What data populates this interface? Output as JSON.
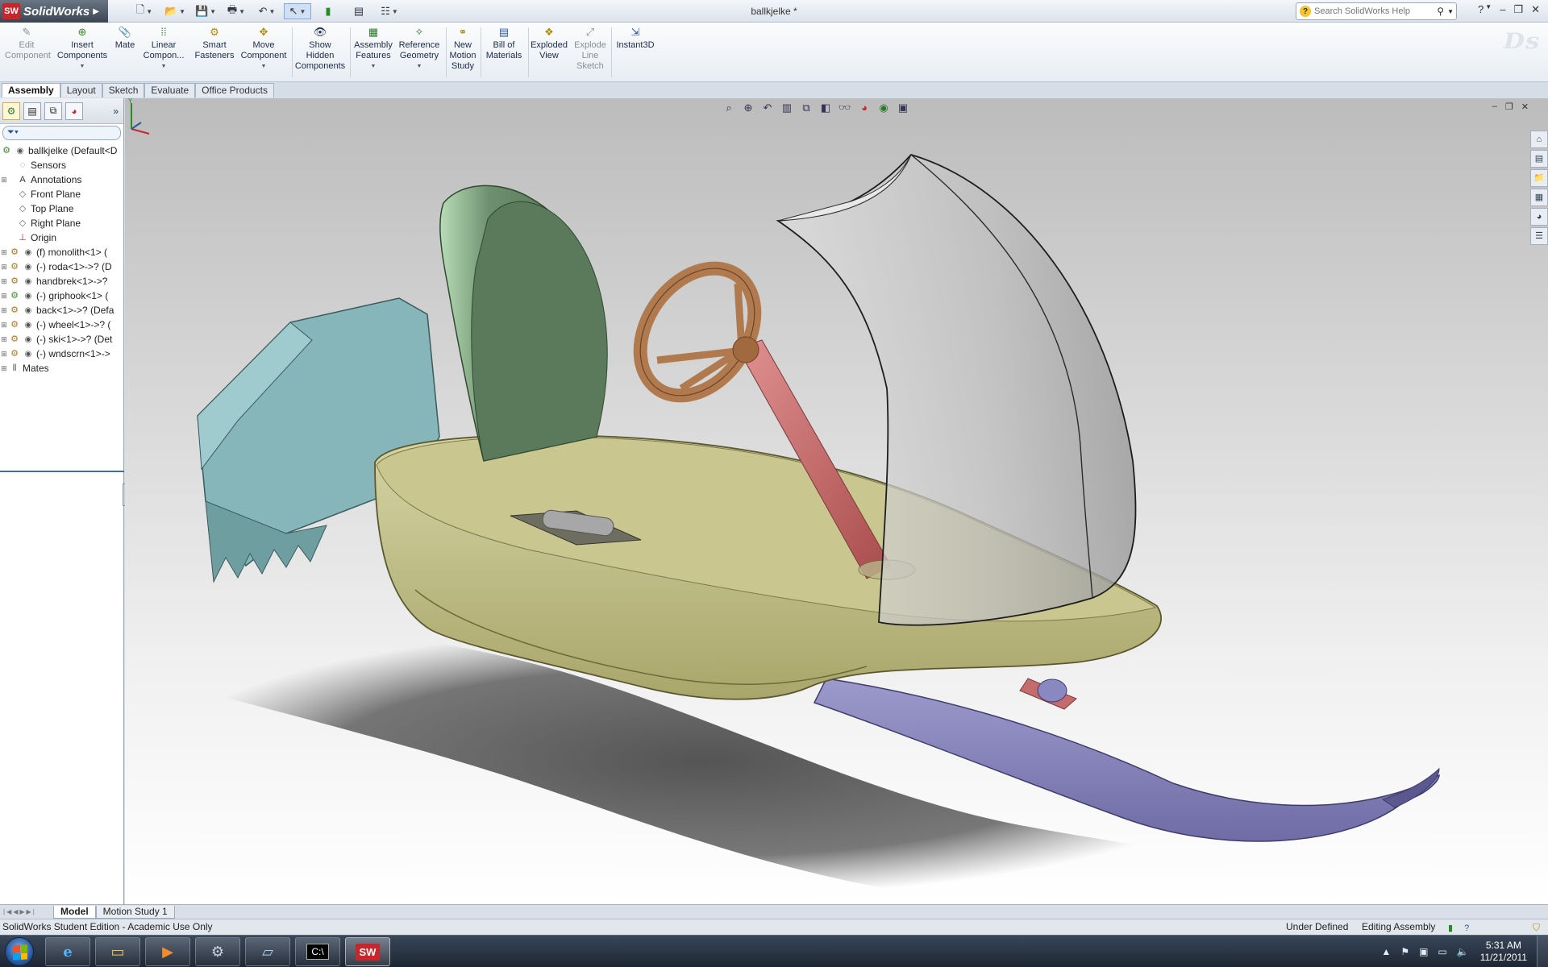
{
  "app": {
    "name": "SolidWorks",
    "logo_mark": "SW",
    "document_title": "ballkjelke *"
  },
  "search": {
    "placeholder": "Search SolidWorks Help"
  },
  "ribbon": {
    "buttons": [
      {
        "label1": "Edit",
        "label2": "Component",
        "icon": "edit-component-icon"
      },
      {
        "label1": "Insert",
        "label2": "Components",
        "icon": "insert-components-icon"
      },
      {
        "label1": "Mate",
        "label2": "",
        "icon": "mate-icon"
      },
      {
        "label1": "Linear",
        "label2": "Compon...",
        "icon": "linear-pattern-icon"
      },
      {
        "label1": "Smart",
        "label2": "Fasteners",
        "icon": "smart-fasteners-icon"
      },
      {
        "label1": "Move",
        "label2": "Component",
        "icon": "move-component-icon"
      },
      {
        "label1": "Show",
        "label2": "Hidden",
        "label3": "Components",
        "icon": "show-hidden-icon"
      },
      {
        "label1": "Assembly",
        "label2": "Features",
        "icon": "assembly-features-icon"
      },
      {
        "label1": "Reference",
        "label2": "Geometry",
        "icon": "reference-geometry-icon"
      },
      {
        "label1": "New",
        "label2": "Motion",
        "label3": "Study",
        "icon": "motion-study-icon"
      },
      {
        "label1": "Bill of",
        "label2": "Materials",
        "icon": "bom-icon"
      },
      {
        "label1": "Exploded",
        "label2": "View",
        "icon": "exploded-view-icon"
      },
      {
        "label1": "Explode",
        "label2": "Line",
        "label3": "Sketch",
        "icon": "explode-line-sketch-icon"
      },
      {
        "label1": "Instant3D",
        "label2": "",
        "icon": "instant3d-icon"
      }
    ]
  },
  "command_tabs": [
    "Assembly",
    "Layout",
    "Sketch",
    "Evaluate",
    "Office Products"
  ],
  "tree": {
    "root": "ballkjelke  (Default<D",
    "items": [
      "Sensors",
      "Annotations",
      "Front Plane",
      "Top Plane",
      "Right Plane",
      "Origin",
      "(f) monolith<1> (",
      "(-) roda<1>->? (D",
      "handbrek<1>->?",
      "(-) griphook<1> (",
      "back<1>->? (Defa",
      "(-) wheel<1>->? (",
      "(-) ski<1>->? (Det",
      "(-) wndscrn<1>->",
      "Mates"
    ]
  },
  "model_tabs": [
    "Model",
    "Motion Study 1"
  ],
  "status": {
    "edition": "SolidWorks Student Edition - Academic Use Only",
    "definition": "Under Defined",
    "mode": "Editing Assembly"
  },
  "clock": {
    "time": "5:31 AM",
    "date": "11/21/2011"
  },
  "colors": {
    "body": "#c8c58e",
    "seat": "#5b7a5b",
    "seat_face": "#9cc59c",
    "rear": "#7fa9ac",
    "wheel": "#b07a4e",
    "shaft": "#c46b6b",
    "ski": "#8a88c0",
    "windscreen": "#cfcfcf"
  }
}
